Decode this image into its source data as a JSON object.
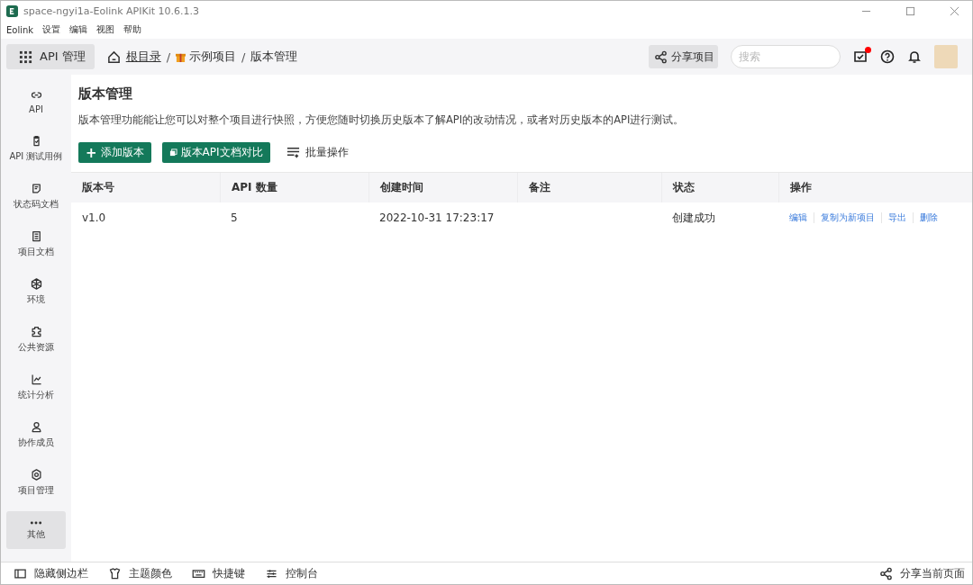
{
  "window": {
    "title": "space-ngyi1a-Eolink APIKit 10.6.1.3"
  },
  "menu": [
    "Eolink",
    "设置",
    "编辑",
    "视图",
    "帮助"
  ],
  "toolbar": {
    "module_button": "API 管理",
    "breadcrumb_separator": "/",
    "breadcrumb": [
      {
        "label": "根目录",
        "kind": "home"
      },
      {
        "label": "示例项目",
        "kind": "project"
      },
      {
        "label": "版本管理",
        "kind": "current"
      }
    ],
    "share_button": "分享项目",
    "search": {
      "placeholder": "搜索"
    },
    "todo_badge": true
  },
  "sidebar": {
    "items": [
      {
        "label": "API",
        "selected": false
      },
      {
        "label": "API 测试用例",
        "selected": false
      },
      {
        "label": "状态码文档",
        "selected": false
      },
      {
        "label": "项目文档",
        "selected": false
      },
      {
        "label": "环境",
        "selected": false
      },
      {
        "label": "公共资源",
        "selected": false
      },
      {
        "label": "统计分析",
        "selected": false
      },
      {
        "label": "协作成员",
        "selected": false
      },
      {
        "label": "项目管理",
        "selected": false
      },
      {
        "label": "其他",
        "selected": true
      }
    ]
  },
  "page": {
    "title": "版本管理",
    "description": "版本管理功能能让您可以对整个项目进行快照，方便您随时切换历史版本了解API的改动情况，或者对历史版本的API进行测试。",
    "actions": [
      {
        "label": "添加版本",
        "kind": "add",
        "icon": "+"
      },
      {
        "label": "版本API文档对比",
        "kind": "compare"
      },
      {
        "label": "批量操作",
        "kind": "batch"
      }
    ]
  },
  "table": {
    "columns": [
      "版本号",
      "API 数量",
      "创建时间",
      "备注",
      "状态",
      "操作"
    ],
    "rows": [
      {
        "version": "v1.0",
        "api_count": "5",
        "created": "2022-10-31 17:23:17",
        "status": "创建成功",
        "operations": [
          "编辑",
          "复制为新项目",
          "导出",
          "删除"
        ]
      }
    ]
  },
  "status_bar": {
    "left": [
      "隐藏侧边栏",
      "主题颜色",
      "快捷键",
      "控制台"
    ],
    "right": "分享当前页面"
  }
}
